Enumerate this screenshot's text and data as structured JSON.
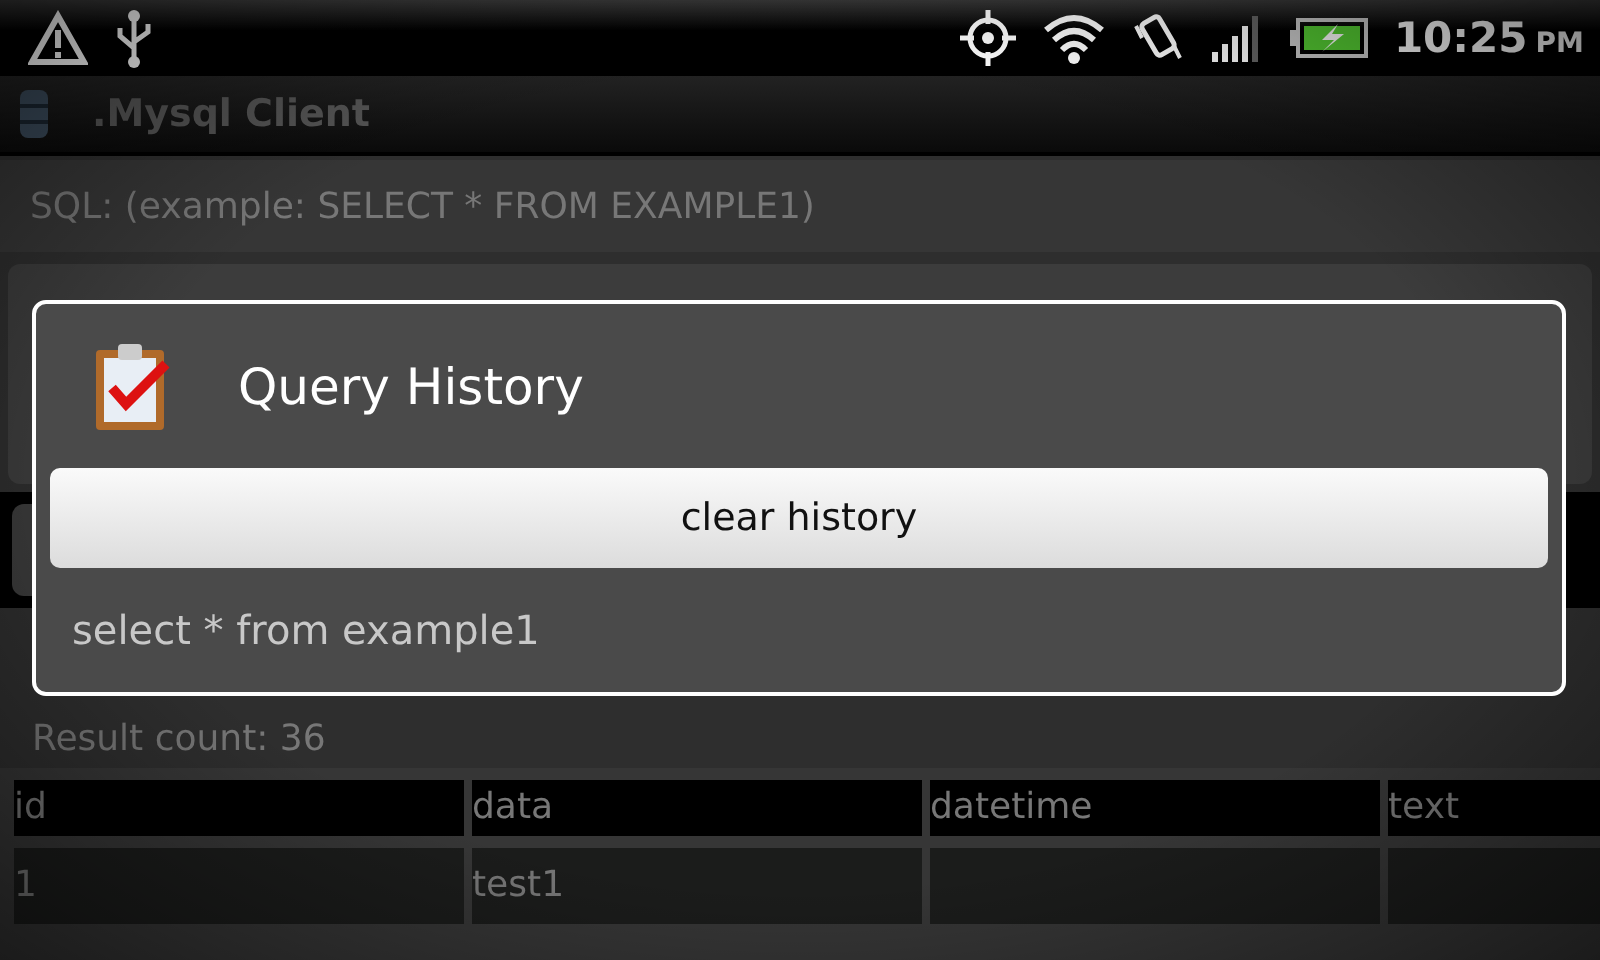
{
  "status_bar": {
    "time": "10:25",
    "ampm": "PM"
  },
  "app_title": ".Mysql Client",
  "sql_field": {
    "placeholder": "SQL: (example: SELECT * FROM EXAMPLE1)"
  },
  "result_count": "Result count: 36",
  "table": {
    "columns": [
      "id",
      "data",
      "datetime",
      "text"
    ],
    "rows": [
      [
        "1",
        "test1"
      ]
    ]
  },
  "dialog": {
    "title": "Query History",
    "button": "clear history",
    "items": [
      "select * from example1"
    ]
  }
}
